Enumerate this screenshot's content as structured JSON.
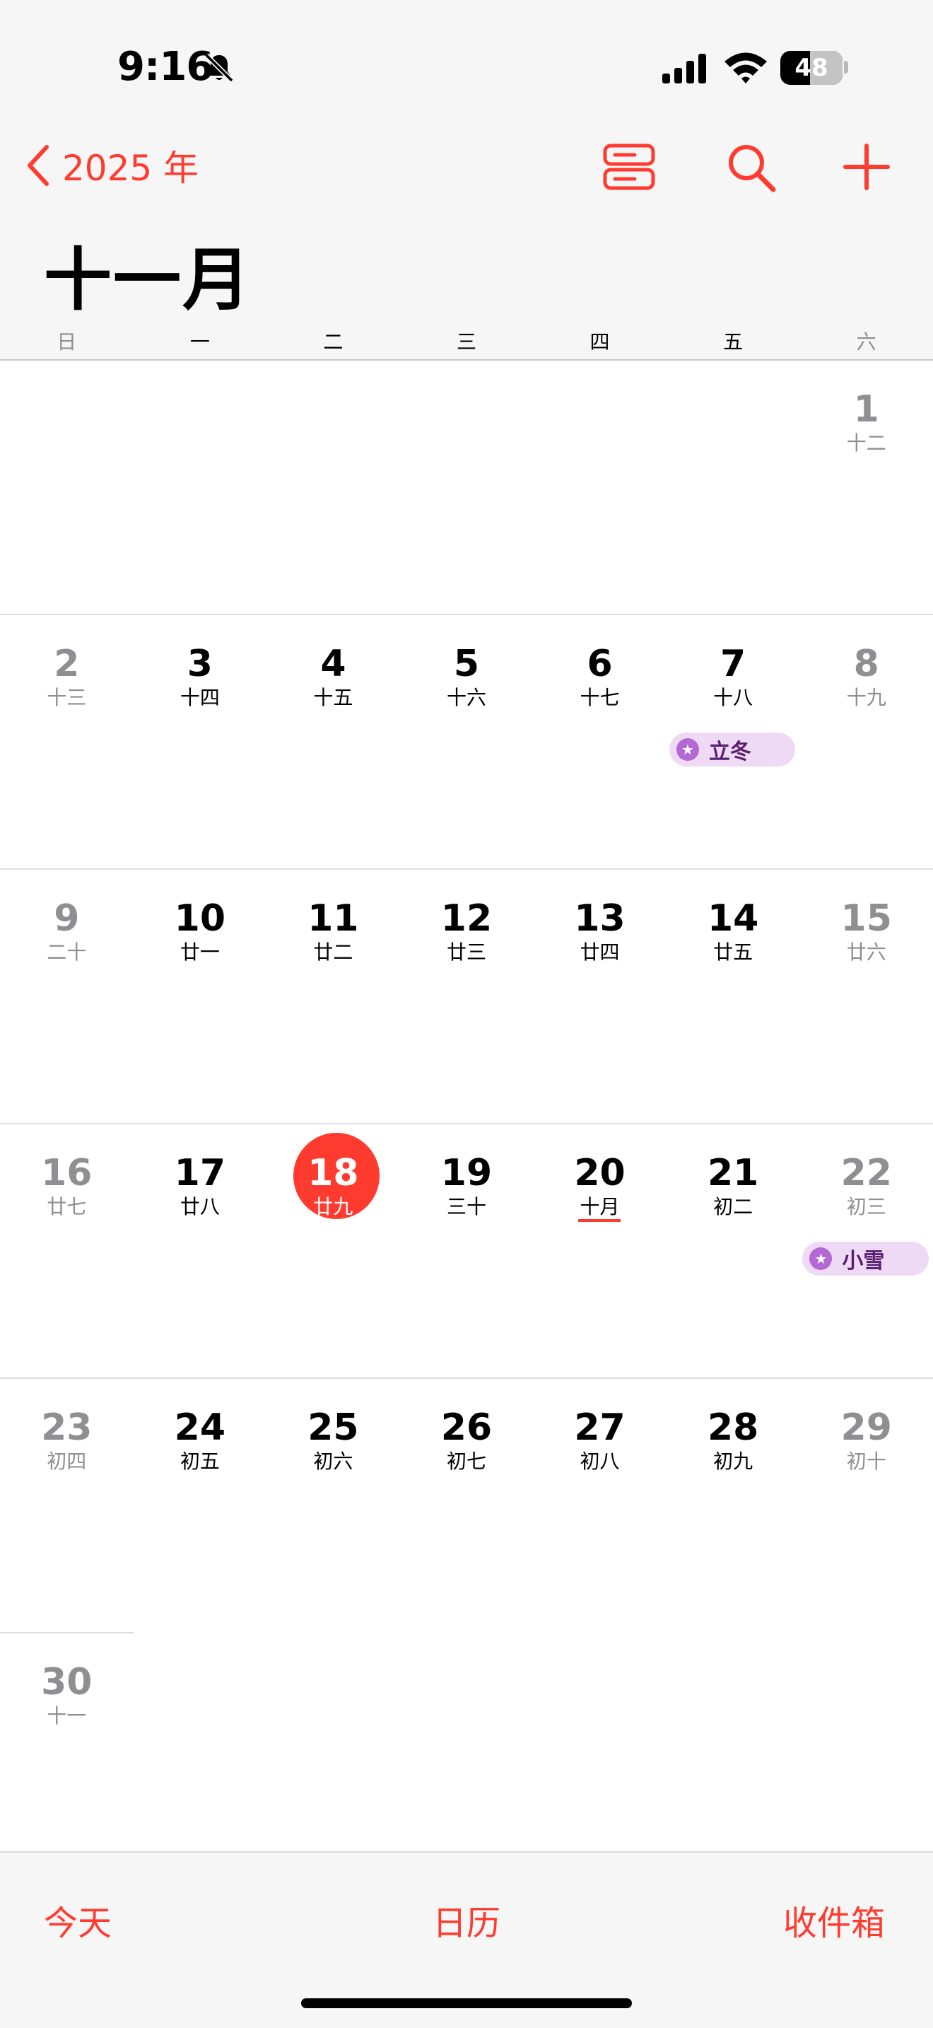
{
  "status_bar": {
    "time": "9:16",
    "battery": "48",
    "battery_level": 0.48
  },
  "nav": {
    "back_label": "2025 年",
    "icons": [
      "list-view-icon",
      "search-icon",
      "plus-icon"
    ]
  },
  "month_title": "十一月",
  "weekdays": [
    "日",
    "一",
    "二",
    "三",
    "四",
    "五",
    "六"
  ],
  "weeks": [
    [
      null,
      null,
      null,
      null,
      null,
      null,
      {
        "d": "1",
        "l": "十二"
      }
    ],
    [
      {
        "d": "2",
        "l": "十三"
      },
      {
        "d": "3",
        "l": "十四"
      },
      {
        "d": "4",
        "l": "十五"
      },
      {
        "d": "5",
        "l": "十六"
      },
      {
        "d": "6",
        "l": "十七"
      },
      {
        "d": "7",
        "l": "十八"
      },
      {
        "d": "8",
        "l": "十九"
      }
    ],
    [
      {
        "d": "9",
        "l": "二十"
      },
      {
        "d": "10",
        "l": "廿一"
      },
      {
        "d": "11",
        "l": "廿二"
      },
      {
        "d": "12",
        "l": "廿三"
      },
      {
        "d": "13",
        "l": "廿四"
      },
      {
        "d": "14",
        "l": "廿五"
      },
      {
        "d": "15",
        "l": "廿六"
      }
    ],
    [
      {
        "d": "16",
        "l": "廿七"
      },
      {
        "d": "17",
        "l": "廿八"
      },
      {
        "d": "18",
        "l": "廿九",
        "today": true
      },
      {
        "d": "19",
        "l": "三十"
      },
      {
        "d": "20",
        "l": "十月",
        "underline": true
      },
      {
        "d": "21",
        "l": "初二"
      },
      {
        "d": "22",
        "l": "初三"
      }
    ],
    [
      {
        "d": "23",
        "l": "初四"
      },
      {
        "d": "24",
        "l": "初五"
      },
      {
        "d": "25",
        "l": "初六"
      },
      {
        "d": "26",
        "l": "初七"
      },
      {
        "d": "27",
        "l": "初八"
      },
      {
        "d": "28",
        "l": "初九"
      },
      {
        "d": "29",
        "l": "初十"
      }
    ],
    [
      {
        "d": "30",
        "l": "十一"
      },
      null,
      null,
      null,
      null,
      null,
      null
    ]
  ],
  "events": [
    {
      "week": 1,
      "col": 5,
      "label": "立冬"
    },
    {
      "week": 3,
      "col": 6,
      "label": "小雪"
    }
  ],
  "toolbar": {
    "today_label": "今天",
    "calendars_label": "日历",
    "inbox_label": "收件箱"
  },
  "colors": {
    "accent": "#ff3b30",
    "event_bg": "#efdaf5",
    "event_icon": "#b468d4",
    "weekend": "#8e8e93"
  }
}
